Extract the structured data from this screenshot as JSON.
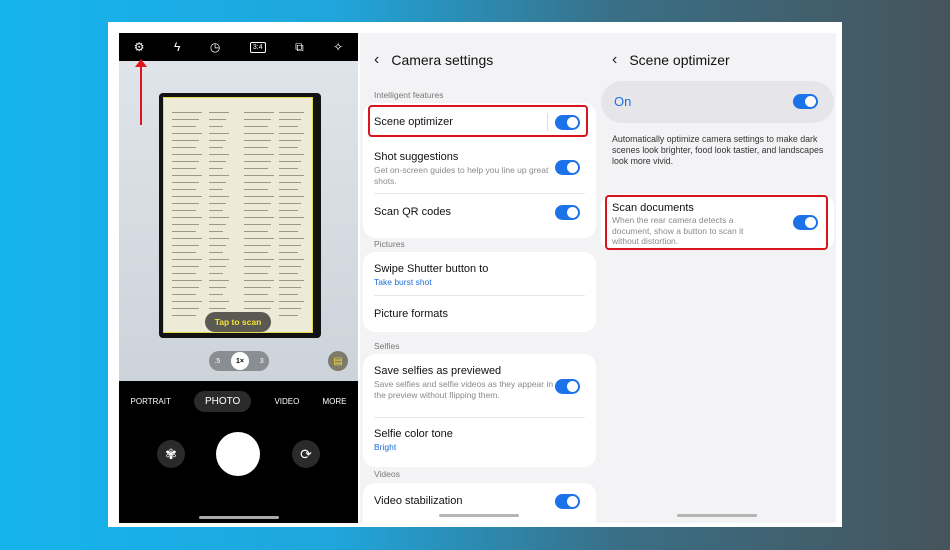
{
  "camera": {
    "top_icons": [
      "gear-icon",
      "flash-off-icon",
      "timer-icon",
      "ratio-3-4-icon",
      "motion-photo-icon",
      "filter-wand-icon"
    ],
    "ratio_label": "3:4",
    "scan_button": "Tap to scan",
    "zoom_levels": [
      ".5",
      "1×",
      "3"
    ],
    "modes": [
      "PORTRAIT",
      "PHOTO",
      "VIDEO",
      "MORE"
    ],
    "selected_mode": "PHOTO"
  },
  "settings": {
    "title": "Camera settings",
    "sections": [
      {
        "label": "Intelligent features"
      },
      {
        "label": "Pictures"
      },
      {
        "label": "Selfies"
      },
      {
        "label": "Videos"
      }
    ],
    "items": [
      {
        "title": "Scene optimizer",
        "on": true
      },
      {
        "title": "Shot suggestions",
        "subtitle": "Get on-screen guides to help you line up great shots.",
        "on": true
      },
      {
        "title": "Scan QR codes",
        "on": true
      },
      {
        "title": "Swipe Shutter button to",
        "value": "Take burst shot"
      },
      {
        "title": "Picture formats"
      },
      {
        "title": "Save selfies as previewed",
        "subtitle": "Save selfies and selfie videos as they appear in the preview without flipping them.",
        "on": true
      },
      {
        "title": "Selfie color tone",
        "value": "Bright"
      },
      {
        "title": "Video stabilization",
        "on": true
      }
    ]
  },
  "scene": {
    "title": "Scene optimizer",
    "master_label": "On",
    "master_on": true,
    "description": "Automatically optimize camera settings to make dark scenes look brighter, food look tastier, and landscapes look more vivid.",
    "scan": {
      "title": "Scan documents",
      "subtitle": "When the rear camera detects a document, show a button to scan it without distortion.",
      "on": true
    }
  },
  "colors": {
    "accent": "#1c72e8",
    "highlight": "#d8141d",
    "scan_text": "#f2e23a"
  }
}
